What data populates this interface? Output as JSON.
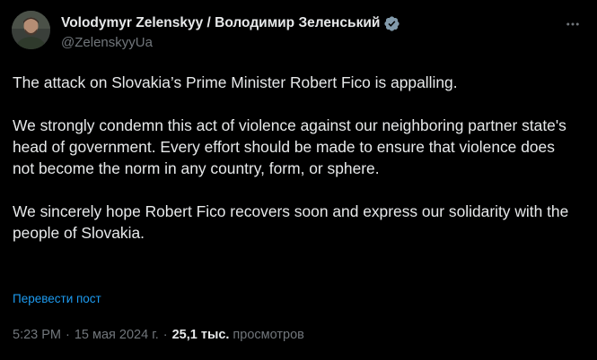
{
  "author": {
    "display_name": "Volodymyr Zelenskyy / Володимир Зеленський",
    "handle": "@ZelenskyyUa",
    "verified": true
  },
  "tweet": {
    "paragraphs": [
      "The attack on Slovakia’s Prime Minister Robert Fico is appalling.",
      "We strongly condemn this act of violence against our neighboring partner state's head of government. Every effort should be made to ensure that violence does not become the norm in any country, form, or sphere.",
      "We sincerely hope Robert Fico recovers soon and express our solidarity with the people of Slovakia."
    ],
    "translate_label": "Перевести пост"
  },
  "meta": {
    "time": "5:23 PM",
    "date": "15 мая 2024 г.",
    "separator": "·",
    "views_count": "25,1 тыс.",
    "views_label": "просмотров"
  },
  "icons": {
    "more": "more-horizontal-icon",
    "verified": "verified-badge-icon"
  },
  "colors": {
    "background": "#000000",
    "text": "#e7e9ea",
    "secondary": "#71767b",
    "link": "#1d9bf0",
    "verified_badge": "#829aab"
  }
}
